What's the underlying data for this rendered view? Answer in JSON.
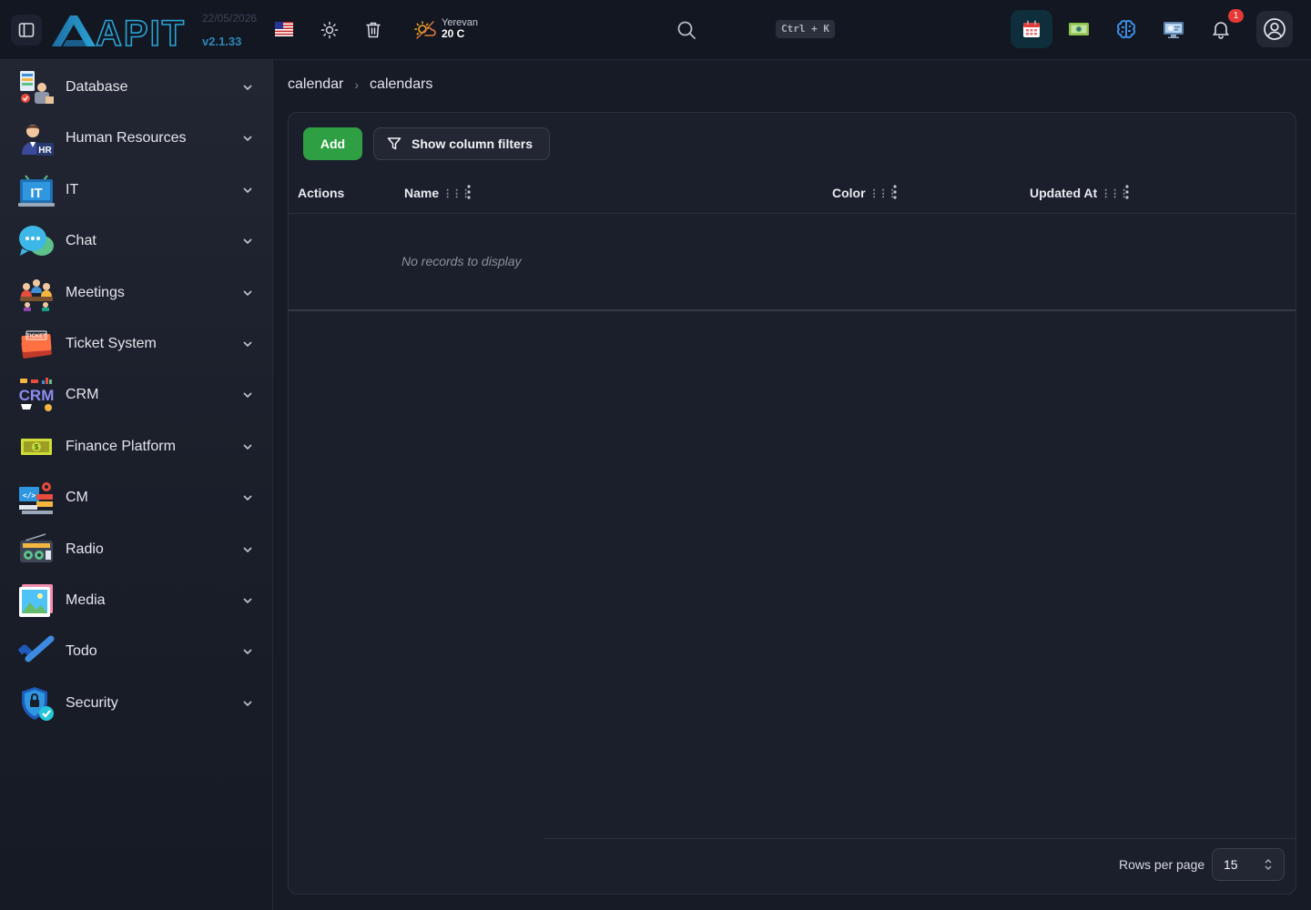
{
  "header": {
    "build_date": "22/05/2026",
    "version": "v2.1.33",
    "logo_text": "APIT",
    "weather": {
      "city": "Yerevan",
      "temp": "20 C"
    },
    "search_shortcut": "Ctrl + K",
    "notification_count": "1",
    "icons": [
      "sidebar-toggle-icon",
      "us-flag-icon",
      "sun-icon",
      "trash-icon",
      "weather-icon",
      "search-icon",
      "calendar-app-icon",
      "finance-app-icon",
      "ai-brain-icon",
      "monitor-app-icon",
      "bell-icon",
      "user-circle-icon"
    ]
  },
  "sidebar": {
    "items": [
      {
        "label": "Database",
        "icon": "database-icon"
      },
      {
        "label": "Human Resources",
        "icon": "hr-icon"
      },
      {
        "label": "IT",
        "icon": "it-icon"
      },
      {
        "label": "Chat",
        "icon": "chat-icon"
      },
      {
        "label": "Meetings",
        "icon": "meetings-icon"
      },
      {
        "label": "Ticket System",
        "icon": "ticket-icon"
      },
      {
        "label": "CRM",
        "icon": "crm-icon"
      },
      {
        "label": "Finance Platform",
        "icon": "finance-icon"
      },
      {
        "label": "CM",
        "icon": "cm-icon"
      },
      {
        "label": "Radio",
        "icon": "radio-icon"
      },
      {
        "label": "Media",
        "icon": "media-icon"
      },
      {
        "label": "Todo",
        "icon": "todo-icon"
      },
      {
        "label": "Security",
        "icon": "security-icon"
      }
    ]
  },
  "breadcrumb": {
    "items": [
      "calendar",
      "calendars"
    ]
  },
  "toolbar": {
    "add_label": "Add",
    "filters_label": "Show column filters"
  },
  "table": {
    "columns": [
      "Actions",
      "Name",
      "Color",
      "Updated At"
    ],
    "empty_message": "No records to display"
  },
  "pagination": {
    "rows_per_page_label": "Rows per page",
    "rows_per_page_value": "15"
  },
  "colors": {
    "accent_green": "#2ea043",
    "badge_red": "#e53935",
    "version_blue": "#2f86b8"
  }
}
